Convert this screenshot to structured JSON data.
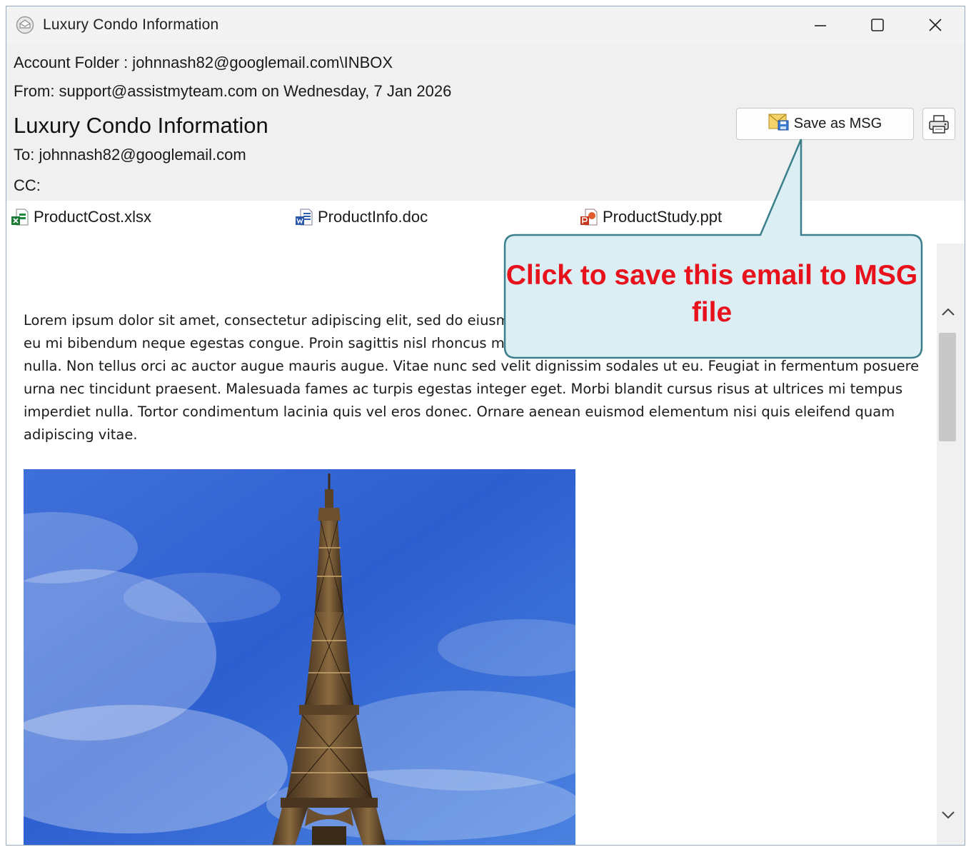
{
  "window": {
    "title": "Luxury Condo Information",
    "controls": {
      "minimize": "minimize-icon",
      "maximize": "maximize-icon",
      "close": "close-icon"
    }
  },
  "header": {
    "account_folder": "Account Folder : johnnash82@googlemail.com\\INBOX",
    "from": "From: support@assistmyteam.com on Wednesday, 7 Jan 2026",
    "subject": "Luxury Condo Information",
    "to": "To: johnnash82@googlemail.com",
    "cc": "CC:"
  },
  "toolbar": {
    "save_label": "Save as MSG",
    "print_icon": "printer-icon"
  },
  "attachments": [
    {
      "name": "ProductCost.xlsx",
      "icon": "excel-file-icon"
    },
    {
      "name": "ProductInfo.doc",
      "icon": "word-file-icon"
    },
    {
      "name": "ProductStudy.ppt",
      "icon": "powerpoint-file-icon"
    }
  ],
  "body": {
    "paragraph": "Lorem ipsum dolor sit amet, consectetur adipiscing elit, sed do eiusmod tempor incididunt ut labore et dolore magna aliqua. In eu mi bibendum neque egestas congue. Proin sagittis nisl rhoncus mattis rhoncus urna neque viverra. Et leo duis ut diam quam nulla. Non tellus orci ac auctor augue mauris augue. Vitae nunc sed velit dignissim sodales ut eu. Feugiat in fermentum posuere urna nec tincidunt praesent. Malesuada fames ac turpis egestas integer eget. Morbi blandit cursus risus at ultrices mi tempus imperdiet nulla. Tortor condimentum lacinia quis vel eros donec. Ornare aenean euismod elementum nisi quis eleifend quam adipiscing vitae.",
    "image": "eiffel-tower-photo"
  },
  "callout": {
    "text": "Click to save this email to MSG file",
    "color": "#e8121c",
    "fill": "#daeef3",
    "border": "#3b7f8c"
  }
}
